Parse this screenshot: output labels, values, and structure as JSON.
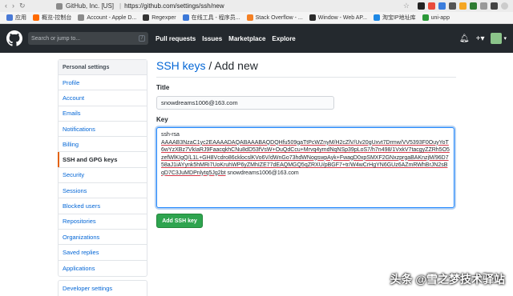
{
  "browser": {
    "tab_title": "GitHub, Inc. [US]",
    "url": "https://github.com/settings/ssh/new"
  },
  "bookmarks": [
    {
      "label": "应用",
      "color": "#4a7ad6"
    },
    {
      "label": "概览-控制台",
      "color": "#ff6a00"
    },
    {
      "label": "Account - Apple D...",
      "color": "#8a8a8a"
    },
    {
      "label": "Regexper",
      "color": "#333333"
    },
    {
      "label": "在线工具 - 程序员...",
      "color": "#3c78d8"
    },
    {
      "label": "Stack Overflow - ...",
      "color": "#f48024"
    },
    {
      "label": "Window - Web AP...",
      "color": "#2c2c2c"
    },
    {
      "label": "淘宝IP地址库",
      "color": "#1e88e5"
    },
    {
      "label": "uni-app",
      "color": "#2b9939"
    }
  ],
  "header": {
    "search_placeholder": "Search or jump to...",
    "search_key": "/",
    "nav": [
      "Pull requests",
      "Issues",
      "Marketplace",
      "Explore"
    ]
  },
  "sidebar": {
    "heading": "Personal settings",
    "items": [
      {
        "label": "Profile",
        "active": false
      },
      {
        "label": "Account",
        "active": false
      },
      {
        "label": "Emails",
        "active": false
      },
      {
        "label": "Notifications",
        "active": false
      },
      {
        "label": "Billing",
        "active": false
      },
      {
        "label": "SSH and GPG keys",
        "active": true
      },
      {
        "label": "Security",
        "active": false
      },
      {
        "label": "Sessions",
        "active": false
      },
      {
        "label": "Blocked users",
        "active": false
      },
      {
        "label": "Repositories",
        "active": false
      },
      {
        "label": "Organizations",
        "active": false
      },
      {
        "label": "Saved replies",
        "active": false
      },
      {
        "label": "Applications",
        "active": false
      }
    ],
    "secondary": "Developer settings"
  },
  "main": {
    "breadcrumb_link": "SSH keys",
    "breadcrumb_rest": " / Add new",
    "title_label": "Title",
    "title_value": "snowdreams1006@163.com",
    "key_label": "Key",
    "key_type": "ssh-rsa",
    "key_value": "AAAAB3NzaC1yc2EAAAADAQABAAABAQDQHfu509gaTtPcWZnyM/H2cZlV/Uv20gUxvt7Drmw/VV5393F0OuyYoT6wYzXBz7VkIaRJ9FaacqkhCNu8dD53fVsW+OuQdCcu+Mrvq4ymdNqNSp39pLoS7/h7n498/1VxkV7tacgyZZRh5O5zefWlKIgQ/L1L+GH8Vcdro86cklocslKVo6V/dWnGo73hdWNogswpAyk+FwagD0xpSMXF2GNxzprgaBAKnzjM/96D758aJ1iAYynk5hMRi7UoKruhWP6yZMhIZE77dEAQMGQ5qZRXU/pBGF7+tr/W4wCrHgYN6GUz6AZmRWhBrJN2sBqD7C3JuMDPnlytq5Jg2bt",
    "key_comment": " snowdreams1006@163.com",
    "submit_label": "Add SSH key"
  },
  "watermark": "头条 @雪之梦技术驿站"
}
